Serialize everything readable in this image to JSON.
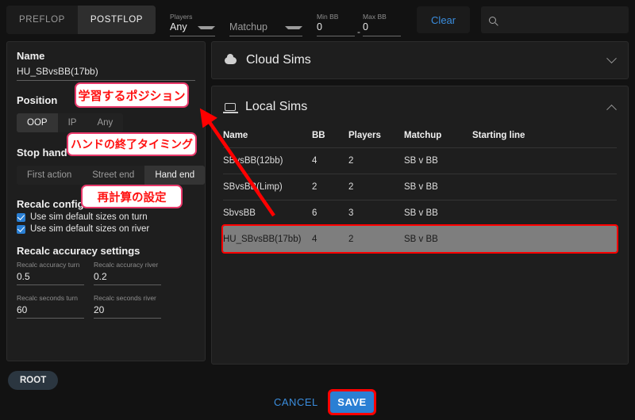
{
  "header": {
    "tabs": [
      {
        "label": "PREFLOP",
        "active": false
      },
      {
        "label": "POSTFLOP",
        "active": true
      }
    ],
    "players_label": "Players",
    "players_value": "Any",
    "matchup_placeholder": "Matchup",
    "min_bb_label": "Min BB",
    "min_bb_value": "0",
    "max_bb_label": "Max BB",
    "max_bb_value": "0",
    "range_dash": "-",
    "clear_label": "Clear",
    "search_placeholder": "",
    "search_value": "",
    "search_icon": "search-icon"
  },
  "sidebar": {
    "name_label": "Name",
    "name_value": "HU_SBvsBB(17bb)",
    "position_label": "Position",
    "position_options": [
      {
        "label": "OOP",
        "active": true
      },
      {
        "label": "IP",
        "active": false
      },
      {
        "label": "Any",
        "active": false
      }
    ],
    "stop_hand_label": "Stop hand",
    "stop_hand_options": [
      {
        "label": "First action",
        "active": false
      },
      {
        "label": "Street end",
        "active": false
      },
      {
        "label": "Hand end",
        "active": true
      }
    ],
    "recalc_config_label": "Recalc config",
    "checkboxes": [
      {
        "label": "Use sim default sizes on turn",
        "checked": true
      },
      {
        "label": "Use sim default sizes on river",
        "checked": true
      }
    ],
    "accuracy_header": "Recalc accuracy settings",
    "inputs": [
      {
        "label": "Recalc accuracy turn",
        "value": "0.5"
      },
      {
        "label": "Recalc accuracy river",
        "value": "0.2"
      },
      {
        "label": "Recalc seconds turn",
        "value": "60"
      },
      {
        "label": "Recalc seconds river",
        "value": "20"
      }
    ]
  },
  "cloud_sims": {
    "title": "Cloud Sims",
    "icon": "cloud-icon",
    "expanded": false,
    "chevron": "chevron-down-icon"
  },
  "local_sims": {
    "title": "Local Sims",
    "icon": "laptop-icon",
    "expanded": true,
    "chevron": "chevron-up-icon",
    "columns": [
      "Name",
      "BB",
      "Players",
      "Matchup",
      "Starting line"
    ],
    "rows": [
      {
        "name": "SBvsBB(12bb)",
        "bb": "4",
        "players": "2",
        "matchup": "SB v BB",
        "starting_line": "",
        "selected": false
      },
      {
        "name": "SBvsBB(Limp)",
        "bb": "2",
        "players": "2",
        "matchup": "SB v BB",
        "starting_line": "",
        "selected": false
      },
      {
        "name": "SbvsBB",
        "bb": "6",
        "players": "3",
        "matchup": "SB v BB",
        "starting_line": "",
        "selected": false
      },
      {
        "name": "HU_SBvsBB(17bb)",
        "bb": "4",
        "players": "2",
        "matchup": "SB v BB",
        "starting_line": "",
        "selected": true
      }
    ]
  },
  "footer": {
    "root_label": "ROOT",
    "cancel_label": "CANCEL",
    "save_label": "SAVE"
  },
  "annotations": {
    "position_note": "学習するポジション",
    "stop_hand_note": "ハンドの終了タイミング",
    "recalc_note": "再計算の設定",
    "arrow": "red-arrow-annotation"
  },
  "colors": {
    "accent_blue": "#2a7fd4",
    "link_blue": "#3a8dde",
    "annotation_red": "#ff0000",
    "annotation_border": "#e8386a",
    "panel_bg": "#1e1e1e",
    "page_bg": "#121212",
    "selected_row": "#7e7e7e"
  }
}
